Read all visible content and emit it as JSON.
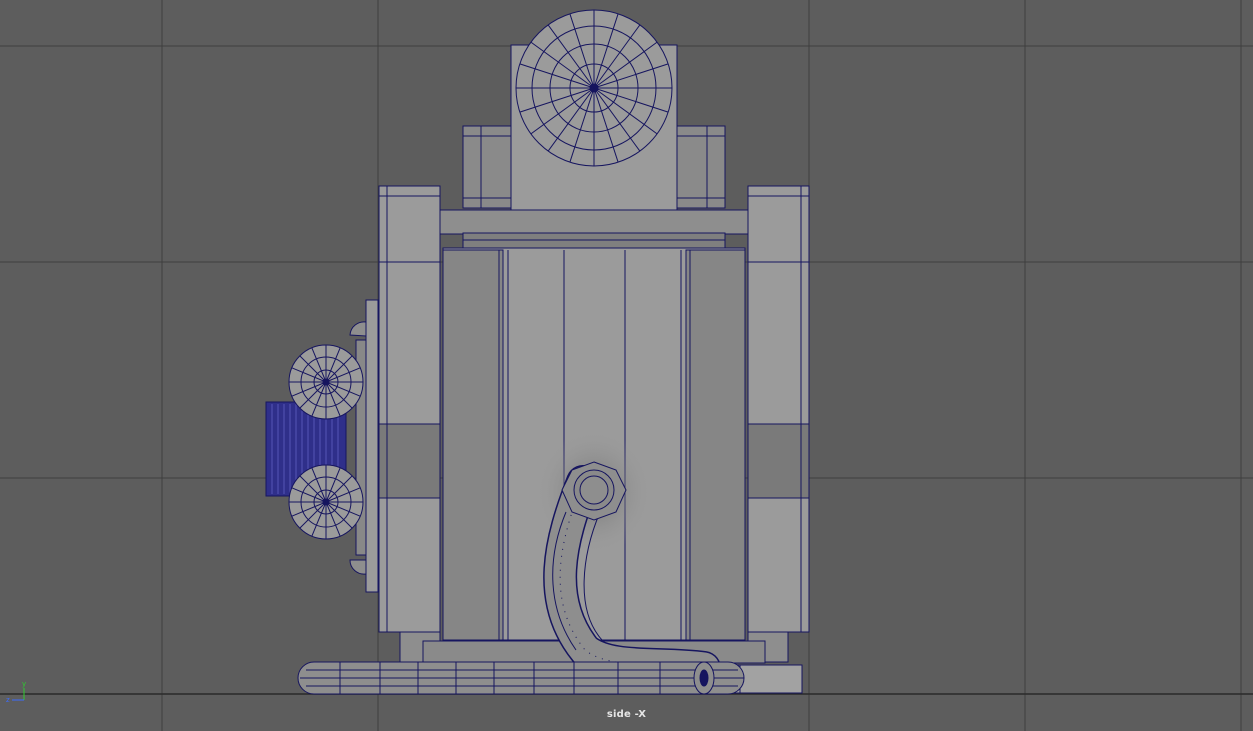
{
  "viewport": {
    "camera_label": "side -X",
    "colors": {
      "background": "#5d5d5d",
      "grid_line": "#3f3f3f",
      "grid_axis": "#2a2a2a",
      "model_fill": "#8e8e8e",
      "model_fill_light": "#9b9b9b",
      "model_fill_dark": "#7a7a7a",
      "wireframe": "#16155f",
      "label_text": "#e6e6e6"
    }
  },
  "axis_gizmo": {
    "y_label": "y",
    "z_label": "z",
    "y_color": "#2ecc2e",
    "z_color": "#3c6cff"
  }
}
